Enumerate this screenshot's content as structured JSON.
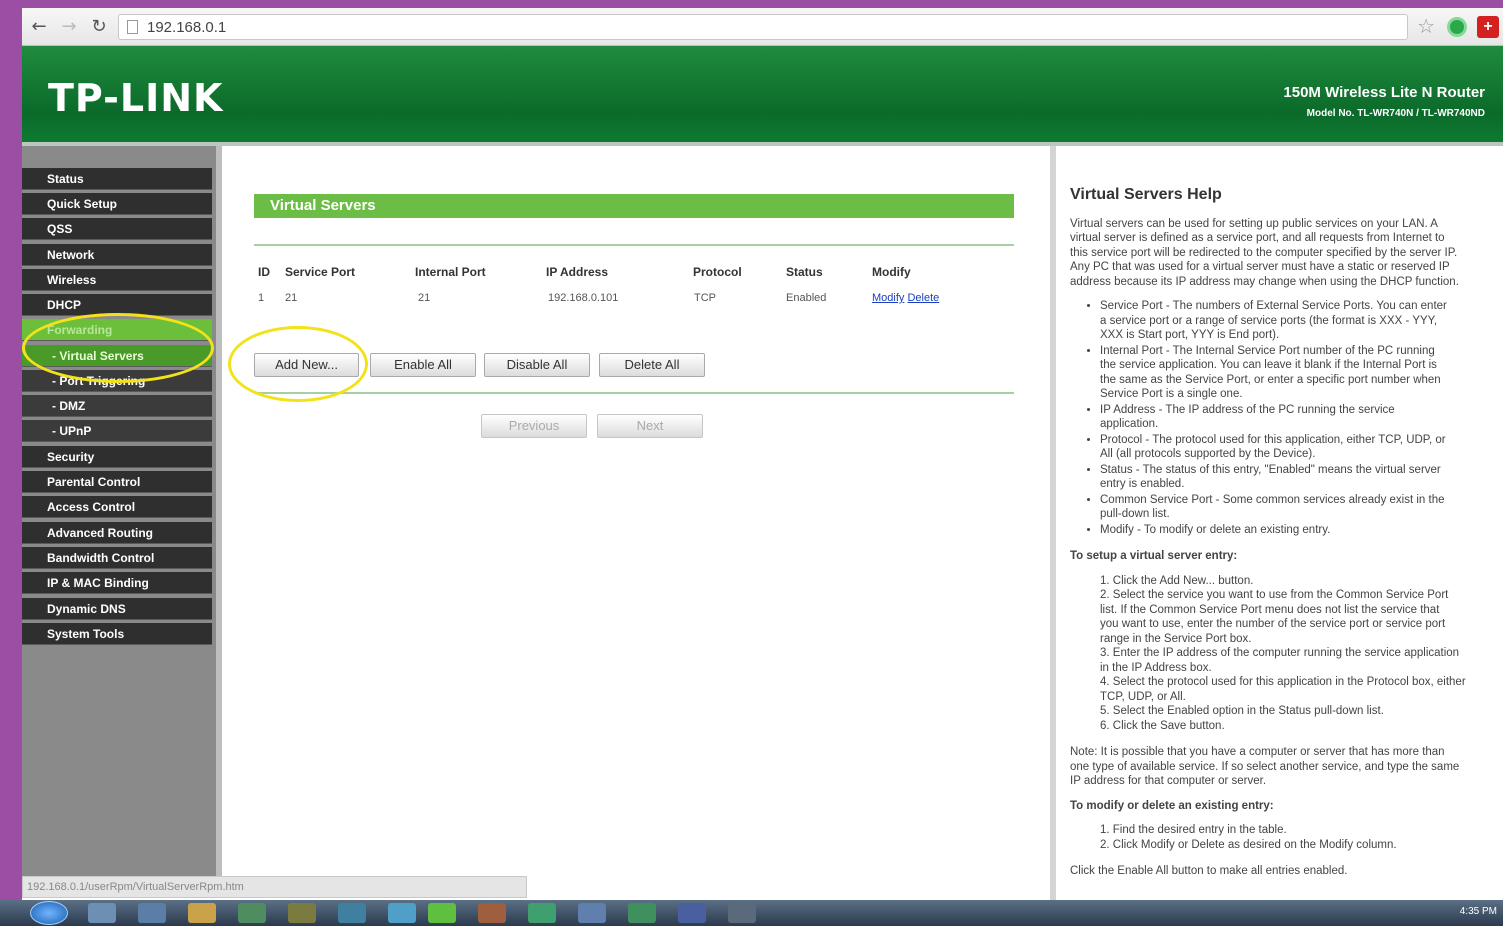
{
  "browser": {
    "url": "192.168.0.1",
    "status_url": "192.168.0.1/userRpm/VirtualServerRpm.htm"
  },
  "banner": {
    "logo": "TP-LINK",
    "product": "150M Wireless Lite N Router",
    "model": "Model No. TL-WR740N / TL-WR740ND"
  },
  "sidebar": {
    "items": [
      {
        "label": "Status"
      },
      {
        "label": "Quick Setup"
      },
      {
        "label": "QSS"
      },
      {
        "label": "Network"
      },
      {
        "label": "Wireless"
      },
      {
        "label": "DHCP"
      },
      {
        "label": "Forwarding"
      },
      {
        "label": "- Virtual Servers"
      },
      {
        "label": "- Port Triggering"
      },
      {
        "label": "- DMZ"
      },
      {
        "label": "- UPnP"
      },
      {
        "label": "Security"
      },
      {
        "label": "Parental Control"
      },
      {
        "label": "Access Control"
      },
      {
        "label": "Advanced Routing"
      },
      {
        "label": "Bandwidth Control"
      },
      {
        "label": "IP & MAC Binding"
      },
      {
        "label": "Dynamic DNS"
      },
      {
        "label": "System Tools"
      }
    ]
  },
  "main": {
    "title": "Virtual Servers",
    "columns": [
      "ID",
      "Service Port",
      "Internal Port",
      "IP Address",
      "Protocol",
      "Status",
      "Modify"
    ],
    "rows": [
      {
        "id": "1",
        "service_port": "21",
        "internal_port": "21",
        "ip": "192.168.0.101",
        "protocol": "TCP",
        "status": "Enabled",
        "modify": "Modify",
        "delete": "Delete"
      }
    ],
    "buttons": {
      "add": "Add New...",
      "enable_all": "Enable All",
      "disable_all": "Disable All",
      "delete_all": "Delete All"
    },
    "pager": {
      "previous": "Previous",
      "next": "Next"
    }
  },
  "help": {
    "title": "Virtual Servers Help",
    "intro": [
      "Virtual servers can be used for setting up public services on your LAN. A",
      "virtual server is defined as a service port, and all requests from Internet to",
      "this service port will be redirected to the computer specified by the server IP.",
      "Any PC that was used for a virtual server must have a static or reserved IP",
      "address because its IP address may change when using the DHCP function."
    ],
    "bullets": [
      "Service Port - The numbers of External Service Ports. You can enter",
      "a service port or a range of service ports (the format is XXX - YYY,",
      "XXX is Start port, YYY is End port).",
      "Internal Port - The Internal Service Port number of the PC running",
      "the service application. You can leave it blank if the Internal Port is",
      "the same as the Service Port, or enter a specific port number when",
      "Service Port is a single one.",
      "IP Address - The IP address of the PC running the service",
      "application.",
      "Protocol - The protocol used for this application, either TCP, UDP, or",
      "All (all protocols supported by the Device).",
      "Status - The status of this entry, \"Enabled\" means the virtual server",
      "entry is enabled.",
      "Common Service Port - Some common services already exist in the",
      "pull-down list.",
      "Modify - To modify or delete an existing entry."
    ],
    "setup_heading": "To setup a virtual server entry:",
    "setup_steps": [
      "1. Click the Add New... button.",
      "2. Select the service you want to use from the Common Service Port",
      "list. If the Common Service Port menu does not list the service that",
      "you want to use, enter the number of the service port or service port",
      "range in the Service Port box.",
      "3. Enter the IP address of the computer running the service application",
      "in the IP Address box.",
      "4. Select the protocol used for this application in the Protocol box, either",
      "TCP, UDP, or All.",
      "5. Select the Enabled option in the Status pull-down list.",
      "6. Click the Save button."
    ],
    "note": [
      "Note: It is possible that you have a computer or server that has more than",
      "one type of available service. If so select another service, and type the same",
      "IP address for that computer or server."
    ],
    "modify_heading": "To modify or delete an existing entry:",
    "modify_steps": [
      "1. Find the desired entry in the table.",
      "2. Click Modify or Delete as desired on the Modify column."
    ],
    "enable_all_note": "Click the Enable All button to make all entries enabled."
  },
  "taskbar": {
    "clock": "4:35 PM"
  },
  "icons": [
    "back-icon",
    "forward-icon",
    "reload-icon",
    "page-icon",
    "star-icon",
    "extension-icon",
    "windows-start-icon"
  ]
}
